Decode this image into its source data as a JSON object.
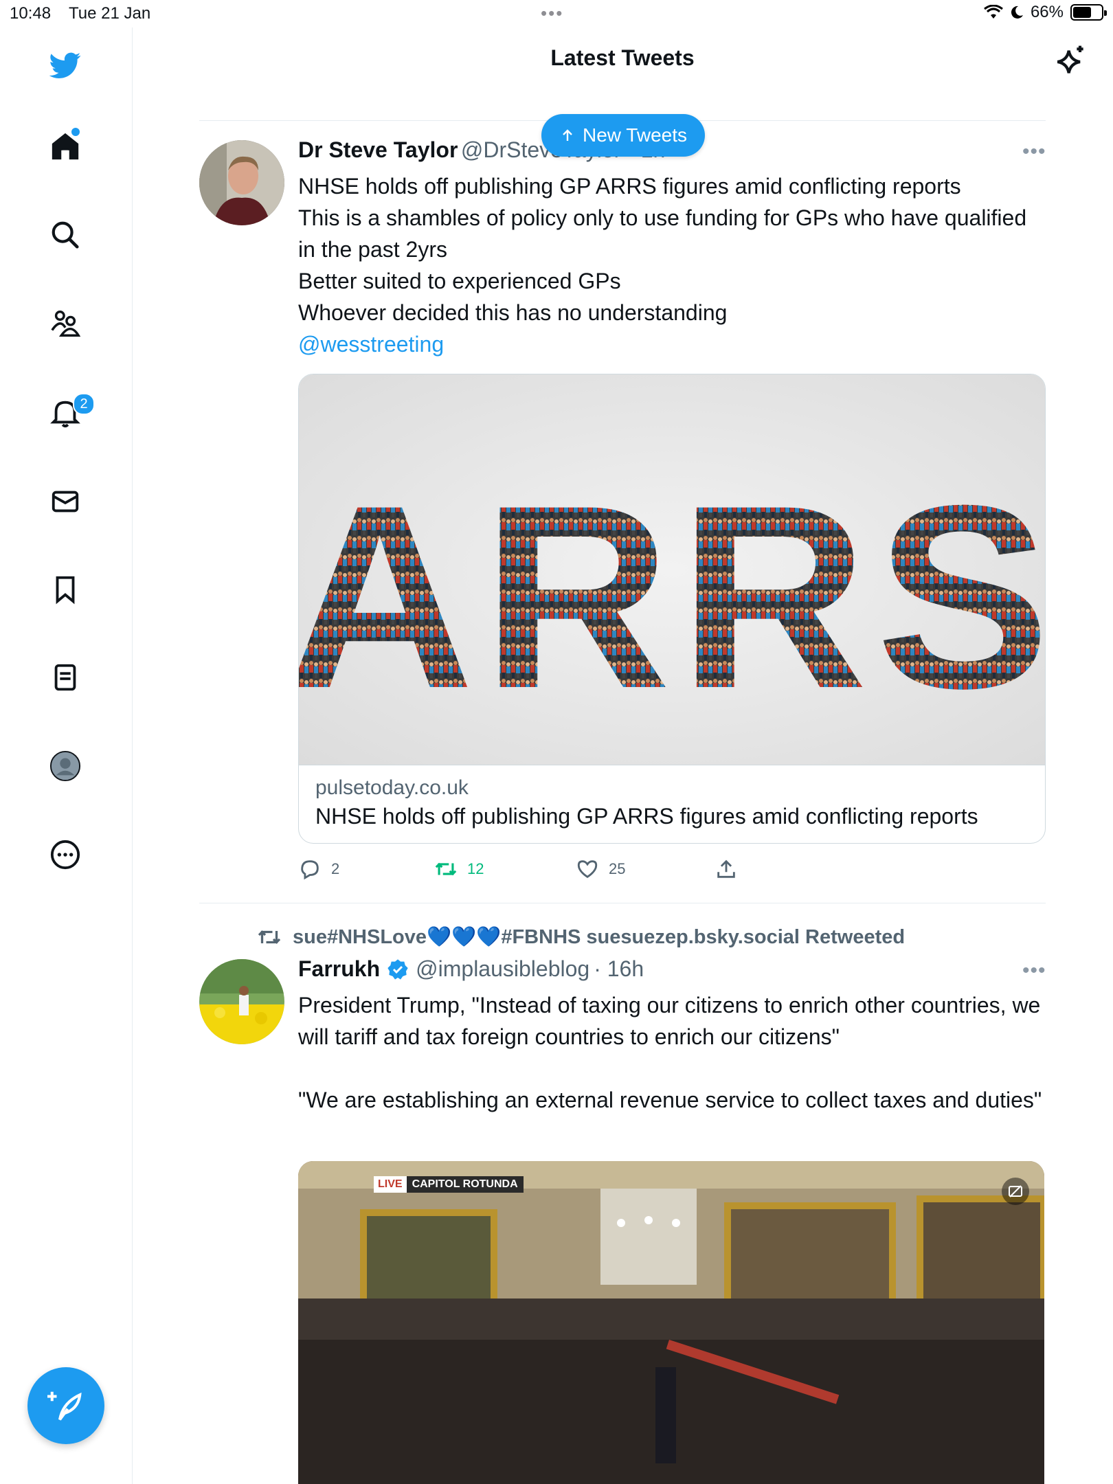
{
  "status_bar": {
    "time": "10:48",
    "date": "Tue 21 Jan",
    "battery": "66%",
    "battery_level": 0.66
  },
  "header": {
    "title": "Latest Tweets"
  },
  "sidebar": {
    "items": [
      {
        "icon": "twitter-logo-icon"
      },
      {
        "icon": "home-icon",
        "has_dot": true
      },
      {
        "icon": "search-icon"
      },
      {
        "icon": "communities-icon"
      },
      {
        "icon": "notifications-icon",
        "badge": "2"
      },
      {
        "icon": "messages-icon"
      },
      {
        "icon": "bookmarks-icon"
      },
      {
        "icon": "lists-icon"
      },
      {
        "icon": "profile-icon"
      },
      {
        "icon": "more-icon"
      }
    ]
  },
  "new_tweets_pill": {
    "label": "New Tweets"
  },
  "tweets": [
    {
      "name": "Dr Steve Taylor",
      "handle": "@DrSteveTaylor · 1h",
      "text": "NHSE holds off publishing GP ARRS figures amid conflicting reports\nThis is a shambles of policy only to use funding for GPs who have qualified in the past 2yrs\nBetter suited to experienced GPs\nWhoever decided this has no understanding",
      "mention": "@wesstreeting",
      "card": {
        "image_word": "ARRS",
        "domain": "pulsetoday.co.uk",
        "title": "NHSE holds off publishing GP ARRS figures amid conflicting reports"
      },
      "replies": "2",
      "retweets": "12",
      "likes": "25",
      "colors": {
        "retweet": "#00ba7c"
      }
    },
    {
      "retweeted_by": "sue#NHSLove💙💙💙#FBNHS suesuezep.bsky.social Retweeted",
      "name": "Farrukh",
      "handle": "@implausibleblog",
      "time": "· 16h",
      "text": "President Trump, \"Instead of taxing our citizens to enrich other countries, we will tariff and tax foreign countries to enrich our citizens\"\n\n\"We are establishing an external revenue service to collect taxes and duties\"",
      "media": {
        "live_label": "LIVE",
        "location": "CAPITOL ROTUNDA"
      }
    }
  ],
  "colors": {
    "accent": "#1d9bf0",
    "text": "#0f1419",
    "secondary": "#536471"
  }
}
